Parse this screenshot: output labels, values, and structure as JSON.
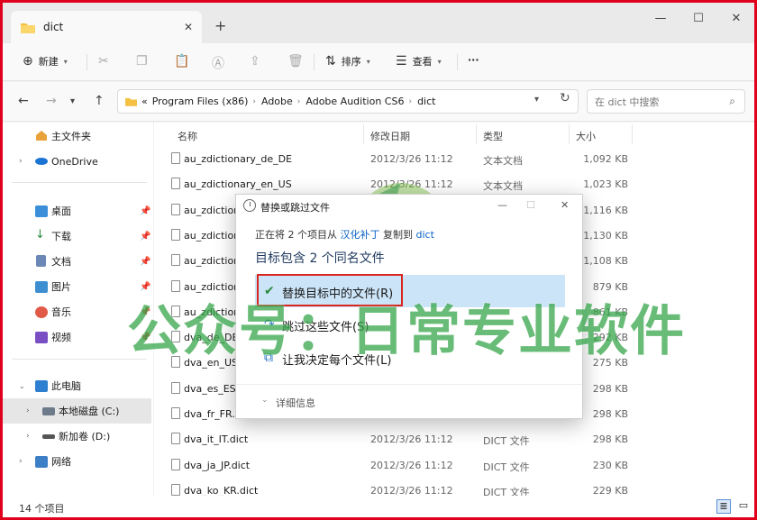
{
  "window": {
    "tab_title": "dict",
    "close_tab": "✕",
    "new_tab": "+",
    "minimize": "—",
    "maximize": "☐",
    "close": "✕"
  },
  "toolbar": {
    "new_label": "新建",
    "sort_label": "排序",
    "view_label": "查看",
    "more_label": "···"
  },
  "address": {
    "overflow": "«",
    "crumbs": [
      "Program Files (x86)",
      "Adobe",
      "Adobe Audition CS6",
      "dict"
    ],
    "search_placeholder": "在 dict 中搜索"
  },
  "sidebar": {
    "items": [
      {
        "label": "主文件夹"
      },
      {
        "label": "OneDrive"
      },
      {
        "label": "桌面"
      },
      {
        "label": "下载"
      },
      {
        "label": "文档"
      },
      {
        "label": "图片"
      },
      {
        "label": "音乐"
      },
      {
        "label": "视频"
      },
      {
        "label": "此电脑"
      },
      {
        "label": "本地磁盘 (C:)"
      },
      {
        "label": "新加卷 (D:)"
      },
      {
        "label": "网络"
      }
    ]
  },
  "columns": {
    "name": "名称",
    "date": "修改日期",
    "type": "类型",
    "size": "大小"
  },
  "files": [
    {
      "name": "au_zdictionary_de_DE",
      "date": "2012/3/26 11:12",
      "type": "文本文档",
      "size": "1,092 KB"
    },
    {
      "name": "au_zdictionary_en_US",
      "date": "2012/3/26 11:12",
      "type": "文本文档",
      "size": "1,023 KB"
    },
    {
      "name": "au_zdiction",
      "date": "",
      "type": "",
      "size": "1,116 KB"
    },
    {
      "name": "au_zdiction",
      "date": "",
      "type": "",
      "size": "1,130 KB"
    },
    {
      "name": "au_zdiction",
      "date": "",
      "type": "",
      "size": "1,108 KB"
    },
    {
      "name": "au_zdiction",
      "date": "",
      "type": "",
      "size": "879 KB"
    },
    {
      "name": "au_zdiction",
      "date": "",
      "type": "",
      "size": "861 KB"
    },
    {
      "name": "dva_de_DE",
      "date": "",
      "type": "",
      "size": "292 KB"
    },
    {
      "name": "dva_en_US.",
      "date": "",
      "type": "",
      "size": "275 KB"
    },
    {
      "name": "dva_es_ES.c",
      "date": "",
      "type": "",
      "size": "298 KB"
    },
    {
      "name": "dva_fr_FR.d",
      "date": "",
      "type": "",
      "size": "298 KB"
    },
    {
      "name": "dva_it_IT.dict",
      "date": "2012/3/26 11:12",
      "type": "DICT 文件",
      "size": "298 KB"
    },
    {
      "name": "dva_ja_JP.dict",
      "date": "2012/3/26 11:12",
      "type": "DICT 文件",
      "size": "230 KB"
    },
    {
      "name": "dva_ko_KR.dict",
      "date": "2012/3/26 11:12",
      "type": "DICT 文件",
      "size": "229 KB"
    }
  ],
  "status": {
    "count": "14 个项目"
  },
  "dialog": {
    "title": "替换或跳过文件",
    "minimize": "—",
    "maximize": "☐",
    "close": "✕",
    "progress_prefix": "正在将 2 个项目从",
    "source": "汉化补丁",
    "progress_mid": "复制到",
    "dest": "dict",
    "heading": "目标包含 2 个同名文件",
    "options": [
      {
        "label": "替换目标中的文件(R)"
      },
      {
        "label": "跳过这些文件(S)"
      },
      {
        "label": "让我决定每个文件(L)"
      }
    ],
    "details": "详细信息"
  },
  "watermark": {
    "text": "公众号：日常专业软件"
  },
  "colors": {
    "frame": "#e0001b",
    "accent_link": "#0a62c9",
    "hover": "#cce4f7",
    "watermark": "#36a64a"
  }
}
